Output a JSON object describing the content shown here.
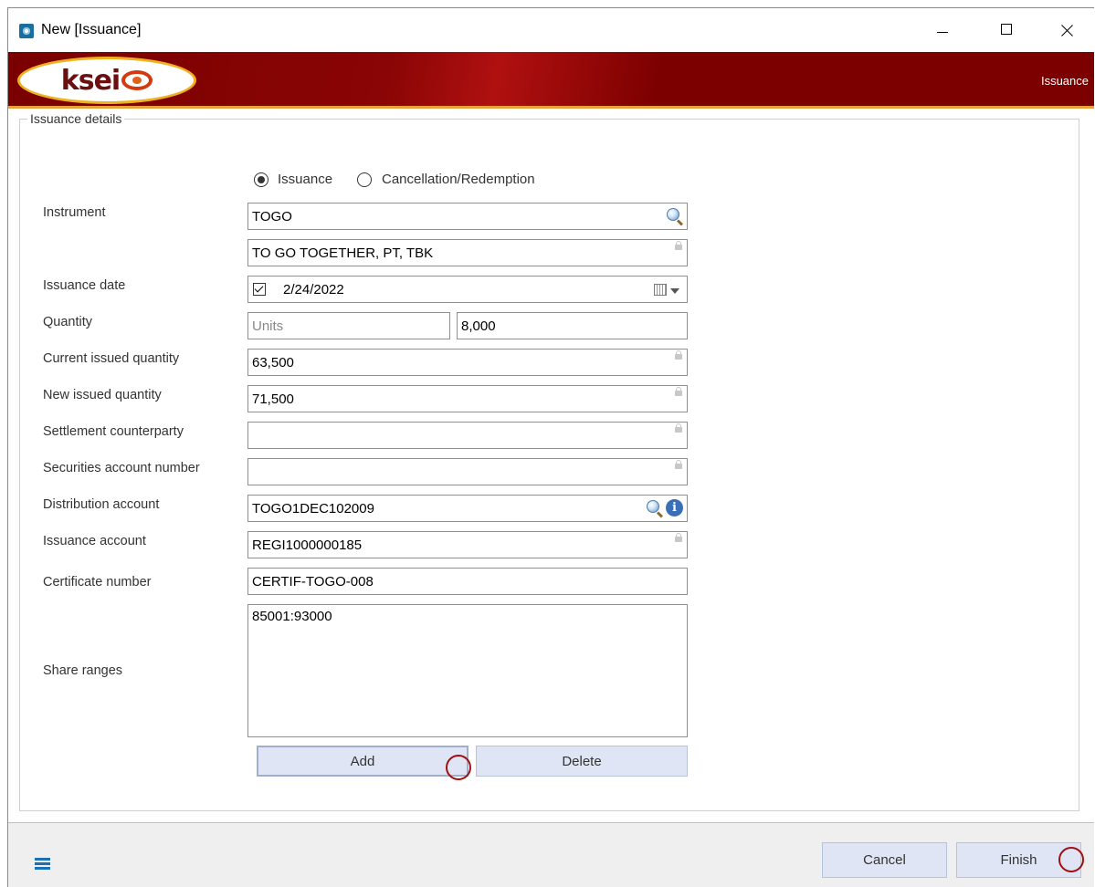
{
  "window": {
    "title": "New [Issuance]"
  },
  "banner": {
    "logo_text": "ksei",
    "section_label": "Issuance"
  },
  "group": {
    "label": "Issuance details"
  },
  "radios": {
    "issuance": "Issuance",
    "cancellation": "Cancellation/Redemption",
    "selected": "Issuance"
  },
  "labels": {
    "instrument": "Instrument",
    "issuance_date": "Issuance date",
    "quantity": "Quantity",
    "current_issued_quantity": "Current issued quantity",
    "new_issued_quantity": "New issued quantity",
    "settlement_counterparty": "Settlement counterparty",
    "securities_account_number": "Securities account number",
    "distribution_account": "Distribution account",
    "issuance_account": "Issuance account",
    "certificate_number": "Certificate number",
    "share_ranges": "Share ranges"
  },
  "values": {
    "instrument_code": "TOGO",
    "instrument_name": "TO GO TOGETHER, PT, TBK",
    "issuance_date": "2/24/2022",
    "quantity_unit": "Units",
    "quantity": "8,000",
    "current_issued_quantity": "63,500",
    "new_issued_quantity": "71,500",
    "settlement_counterparty": "",
    "securities_account_number": "",
    "distribution_account": "TOGO1DEC102009",
    "issuance_account": "REGI1000000185",
    "certificate_number": "CERTIF-TOGO-008",
    "share_ranges": "85001:93000"
  },
  "buttons": {
    "add": "Add",
    "delete": "Delete",
    "cancel": "Cancel",
    "finish": "Finish"
  },
  "colors": {
    "banner": "#7c0000",
    "accent": "#e8a13a",
    "button_bg": "#dfe5f5",
    "marker": "#a01010"
  },
  "icons": [
    "search-icon",
    "lock-icon",
    "calendar-icon",
    "info-icon",
    "menu-icon",
    "close-icon",
    "maximize-icon",
    "minimize-icon"
  ]
}
